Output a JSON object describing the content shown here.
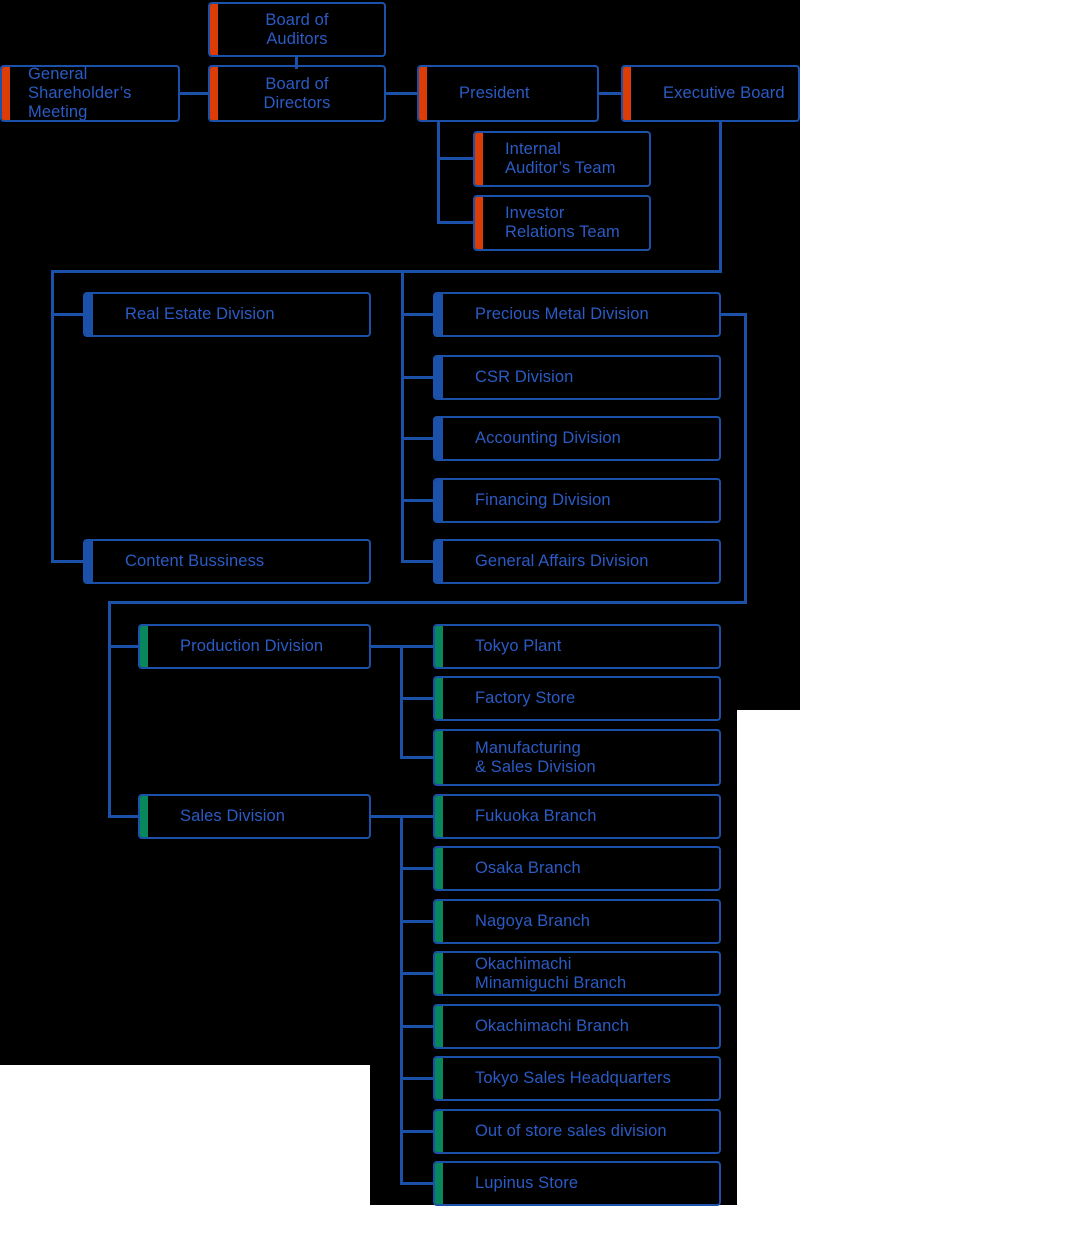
{
  "chart_data": {
    "type": "diagram",
    "title": "Corporate Organization Chart",
    "accent_colors": {
      "orange": "#DC3C06",
      "blue": "#1B51A8",
      "green": "#07875B",
      "text": "#2B5BC4",
      "background": "#000000"
    },
    "governance": [
      {
        "id": "board_of_auditors",
        "label": "Board of\nAuditors",
        "accent": "orange"
      },
      {
        "id": "general_shareholders_meeting",
        "label": "General\nShareholder’s\nMeeting",
        "accent": "orange"
      },
      {
        "id": "board_of_directors",
        "label": "Board of\nDirectors",
        "accent": "orange"
      },
      {
        "id": "president",
        "label": "President",
        "accent": "orange"
      },
      {
        "id": "executive_board",
        "label": "Executive Board",
        "accent": "orange"
      },
      {
        "id": "internal_auditors_team",
        "label": "Internal\nAuditor’s Team",
        "accent": "orange"
      },
      {
        "id": "investor_relations_team",
        "label": "Investor\nRelations Team",
        "accent": "orange"
      }
    ],
    "divisions_left": [
      {
        "id": "real_estate_division",
        "label": "Real Estate Division",
        "accent": "blue"
      },
      {
        "id": "content_bussiness",
        "label": "Content Bussiness",
        "accent": "blue"
      }
    ],
    "divisions_center": [
      {
        "id": "precious_metal_division",
        "label": "Precious Metal Division",
        "accent": "blue"
      },
      {
        "id": "csr_division",
        "label": "CSR Division",
        "accent": "blue"
      },
      {
        "id": "accounting_division",
        "label": "Accounting Division",
        "accent": "blue"
      },
      {
        "id": "financing_division",
        "label": "Financing Division",
        "accent": "blue"
      },
      {
        "id": "general_affairs_division",
        "label": "General Affairs Division",
        "accent": "blue"
      }
    ],
    "operations_parents": [
      {
        "id": "production_division",
        "label": "Production Division",
        "accent": "green"
      },
      {
        "id": "sales_division",
        "label": "Sales Division",
        "accent": "green"
      }
    ],
    "production_children": [
      {
        "id": "tokyo_plant",
        "label": "Tokyo Plant",
        "accent": "green"
      },
      {
        "id": "factory_store",
        "label": "Factory Store",
        "accent": "green"
      },
      {
        "id": "manufacturing_sales_division",
        "label": "Manufacturing\n& Sales Division",
        "accent": "green"
      }
    ],
    "sales_children": [
      {
        "id": "fukuoka_branch",
        "label": "Fukuoka Branch",
        "accent": "green"
      },
      {
        "id": "osaka_branch",
        "label": "Osaka Branch",
        "accent": "green"
      },
      {
        "id": "nagoya_branch",
        "label": "Nagoya Branch",
        "accent": "green"
      },
      {
        "id": "okachimachi_minamiguchi_branch",
        "label": "Okachimachi\nMinamiguchi Branch",
        "accent": "green"
      },
      {
        "id": "okachimachi_branch",
        "label": "Okachimachi Branch",
        "accent": "green"
      },
      {
        "id": "tokyo_sales_headquarters",
        "label": "Tokyo Sales Headquarters",
        "accent": "green"
      },
      {
        "id": "out_of_store_sales_division",
        "label": "Out of store sales division",
        "accent": "green"
      },
      {
        "id": "lupinus_store",
        "label": "Lupinus Store",
        "accent": "green"
      }
    ]
  },
  "nodes": {
    "board_of_auditors": "Board of\nAuditors",
    "general_shareholders_meeting": "General\nShareholder’s\nMeeting",
    "board_of_directors": "Board of\nDirectors",
    "president": "President",
    "executive_board": "Executive Board",
    "internal_auditors_team": "Internal\nAuditor’s Team",
    "investor_relations_team": "Investor\nRelations Team",
    "real_estate_division": "Real Estate Division",
    "content_bussiness": "Content Bussiness",
    "precious_metal_division": "Precious Metal Division",
    "csr_division": "CSR Division",
    "accounting_division": "Accounting Division",
    "financing_division": "Financing Division",
    "general_affairs_division": "General Affairs Division",
    "production_division": "Production Division",
    "sales_division": "Sales Division",
    "tokyo_plant": "Tokyo Plant",
    "factory_store": "Factory Store",
    "manufacturing_sales_division": "Manufacturing\n& Sales Division",
    "fukuoka_branch": "Fukuoka Branch",
    "osaka_branch": "Osaka Branch",
    "nagoya_branch": "Nagoya Branch",
    "okachimachi_minamiguchi_branch": "Okachimachi\nMinamiguchi Branch",
    "okachimachi_branch": "Okachimachi Branch",
    "tokyo_sales_headquarters": "Tokyo Sales Headquarters",
    "out_of_store_sales_division": "Out of store sales division",
    "lupinus_store": "Lupinus Store"
  }
}
